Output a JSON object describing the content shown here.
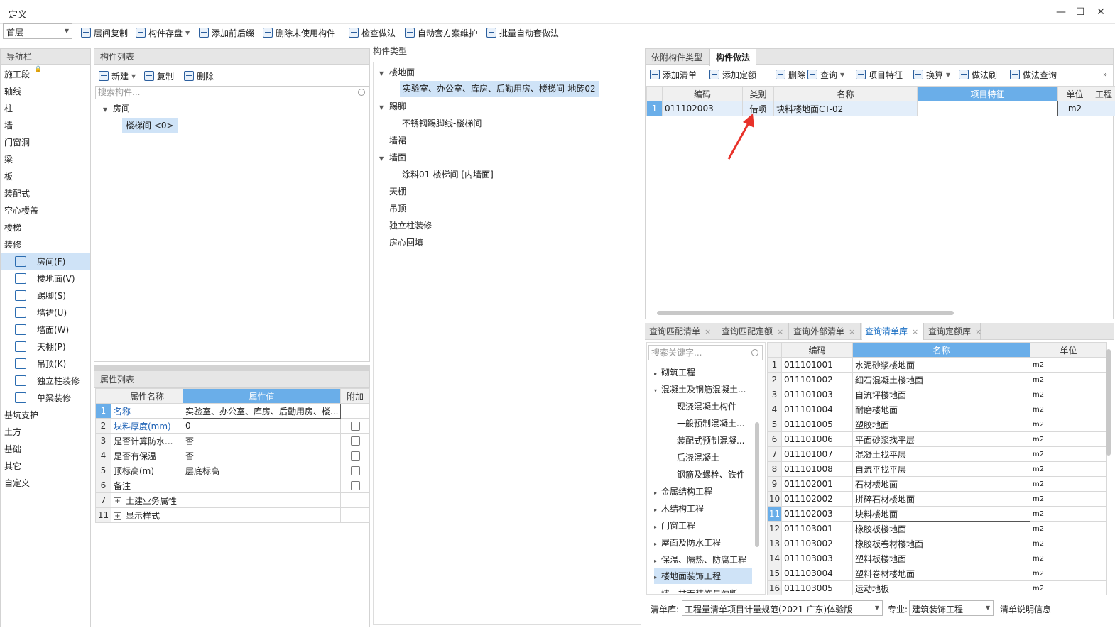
{
  "window": {
    "title": "定义"
  },
  "toolbar": {
    "floor": "首层",
    "buttons": [
      "层间复制",
      "构件存盘",
      "添加前后缀",
      "删除未使用构件",
      "检查做法",
      "自动套方案维护",
      "批量自动套做法"
    ]
  },
  "nav": {
    "header": "导航栏",
    "items": [
      "施工段",
      "轴线",
      "柱",
      "墙",
      "门窗洞",
      "梁",
      "板",
      "装配式",
      "空心楼盖",
      "楼梯",
      "装修"
    ],
    "sub_items": [
      "房间(F)",
      "楼地面(V)",
      "踢脚(S)",
      "墙裙(U)",
      "墙面(W)",
      "天棚(P)",
      "吊顶(K)",
      "独立柱装修",
      "单梁装修"
    ],
    "bottom_items": [
      "基坑支护",
      "土方",
      "基础",
      "其它",
      "自定义"
    ]
  },
  "component_list": {
    "header": "构件列表",
    "buttons": [
      "新建",
      "复制",
      "删除"
    ],
    "search_placeholder": "搜索构件...",
    "tree_root": "房间",
    "tree_child": "楼梯间 <0>"
  },
  "properties": {
    "header": "属性列表",
    "columns": [
      "属性名称",
      "属性值",
      "附加"
    ],
    "rows": [
      {
        "n": "1",
        "name": "名称",
        "value": "实验室、办公室、库房、后勤用房、楼...",
        "checkbox": false,
        "expand": false
      },
      {
        "n": "2",
        "name": "块料厚度(mm)",
        "value": "0",
        "checkbox": true,
        "expand": false
      },
      {
        "n": "3",
        "name": "是否计算防水...",
        "value": "否",
        "checkbox": true,
        "expand": false
      },
      {
        "n": "4",
        "name": "是否有保温",
        "value": "否",
        "checkbox": true,
        "expand": false
      },
      {
        "n": "5",
        "name": "顶标高(m)",
        "value": "层底标高",
        "checkbox": true,
        "expand": false
      },
      {
        "n": "6",
        "name": "备注",
        "value": "",
        "checkbox": true,
        "expand": false
      },
      {
        "n": "7",
        "name": "土建业务属性",
        "value": "",
        "checkbox": false,
        "expand": true
      },
      {
        "n": "11",
        "name": "显示样式",
        "value": "",
        "checkbox": false,
        "expand": true
      }
    ]
  },
  "component_types": {
    "header": "构件类型",
    "items": [
      {
        "label": "楼地面",
        "level": 0,
        "expanded": true
      },
      {
        "label": "实验室、办公室、库房、后勤用房、楼梯间-地砖02",
        "level": 1,
        "selected": true
      },
      {
        "label": "踢脚",
        "level": 0,
        "expanded": true
      },
      {
        "label": "不锈钢踢脚线-楼梯间",
        "level": 1
      },
      {
        "label": "墙裙",
        "level": 0
      },
      {
        "label": "墙面",
        "level": 0,
        "expanded": true
      },
      {
        "label": "涂料01-楼梯间 [内墙面]",
        "level": 1
      },
      {
        "label": "天棚",
        "level": 0
      },
      {
        "label": "吊顶",
        "level": 0
      },
      {
        "label": "独立柱装修",
        "level": 0
      },
      {
        "label": "房心回填",
        "level": 0
      }
    ]
  },
  "method_panel": {
    "tabs": [
      "依附构件类型",
      "构件做法"
    ],
    "buttons": [
      "添加清单",
      "添加定额",
      "删除",
      "查询",
      "项目特征",
      "换算",
      "做法刷",
      "做法查询"
    ],
    "columns": [
      "编码",
      "类别",
      "名称",
      "项目特征",
      "单位",
      "工程"
    ],
    "rows": [
      {
        "n": "1",
        "code": "011102003",
        "category": "借项",
        "name": "块料楼地面CT-02",
        "feature": "",
        "unit": "m2"
      }
    ]
  },
  "query_panel": {
    "tabs": [
      "查询匹配清单",
      "查询匹配定额",
      "查询外部清单",
      "查询清单库",
      "查询定额库"
    ],
    "search_placeholder": "搜索关键字...",
    "tree": [
      {
        "label": "砌筑工程",
        "level": 0,
        "arrow": "▸"
      },
      {
        "label": "混凝土及钢筋混凝土...",
        "level": 0,
        "arrow": "▾"
      },
      {
        "label": "现浇混凝土构件",
        "level": 1
      },
      {
        "label": "一般预制混凝土...",
        "level": 1
      },
      {
        "label": "装配式预制混凝...",
        "level": 1
      },
      {
        "label": "后浇混凝土",
        "level": 1
      },
      {
        "label": "钢筋及螺栓、铁件",
        "level": 1
      },
      {
        "label": "金属结构工程",
        "level": 0,
        "arrow": "▸"
      },
      {
        "label": "木结构工程",
        "level": 0,
        "arrow": "▸"
      },
      {
        "label": "门窗工程",
        "level": 0,
        "arrow": "▸"
      },
      {
        "label": "屋面及防水工程",
        "level": 0,
        "arrow": "▸"
      },
      {
        "label": "保温、隔热、防腐工程",
        "level": 0,
        "arrow": "▸"
      },
      {
        "label": "楼地面装饰工程",
        "level": 0,
        "arrow": "▸",
        "selected": true
      },
      {
        "label": "墙、柱面装饰与隔断...",
        "level": 0,
        "arrow": "▸"
      }
    ],
    "columns": [
      "编码",
      "名称",
      "单位"
    ],
    "rows": [
      {
        "n": "1",
        "code": "011101001",
        "name": "水泥砂浆楼地面",
        "unit": "m2"
      },
      {
        "n": "2",
        "code": "011101002",
        "name": "细石混凝土楼地面",
        "unit": "m2"
      },
      {
        "n": "3",
        "code": "011101003",
        "name": "自流坪楼地面",
        "unit": "m2"
      },
      {
        "n": "4",
        "code": "011101004",
        "name": "耐磨楼地面",
        "unit": "m2"
      },
      {
        "n": "5",
        "code": "011101005",
        "name": "塑胶地面",
        "unit": "m2"
      },
      {
        "n": "6",
        "code": "011101006",
        "name": "平面砂浆找平层",
        "unit": "m2"
      },
      {
        "n": "7",
        "code": "011101007",
        "name": "混凝土找平层",
        "unit": "m2"
      },
      {
        "n": "8",
        "code": "011101008",
        "name": "自流平找平层",
        "unit": "m2"
      },
      {
        "n": "9",
        "code": "011102001",
        "name": "石材楼地面",
        "unit": "m2"
      },
      {
        "n": "10",
        "code": "011102002",
        "name": "拼碎石材楼地面",
        "unit": "m2"
      },
      {
        "n": "11",
        "code": "011102003",
        "name": "块料楼地面",
        "unit": "m2",
        "selected": true
      },
      {
        "n": "12",
        "code": "011103001",
        "name": "橡胶板楼地面",
        "unit": "m2"
      },
      {
        "n": "13",
        "code": "011103002",
        "name": "橡胶板卷材楼地面",
        "unit": "m2"
      },
      {
        "n": "14",
        "code": "011103003",
        "name": "塑料板楼地面",
        "unit": "m2"
      },
      {
        "n": "15",
        "code": "011103004",
        "name": "塑料卷材楼地面",
        "unit": "m2"
      },
      {
        "n": "16",
        "code": "011103005",
        "name": "运动地板",
        "unit": "m2"
      }
    ],
    "footer": {
      "lib_label": "清单库:",
      "lib_value": "工程量清单项目计量规范(2021-广东)体验版",
      "spec_label": "专业:",
      "spec_value": "建筑装饰工程",
      "info": "清单说明信息"
    }
  },
  "colors": {
    "accent": "#6aaee9",
    "selection": "#cfe3f7",
    "annotation_arrow": "#e8322a"
  }
}
